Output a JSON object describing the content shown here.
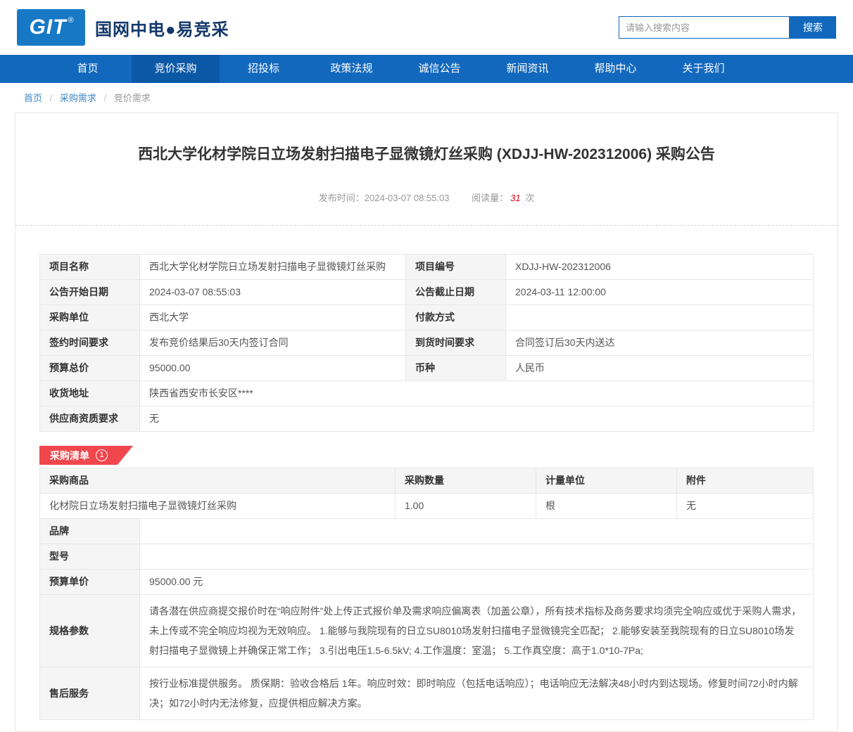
{
  "colors": {
    "brand_blue": "#1268bd",
    "active_nav_blue": "#0b58a6",
    "logo_blue": "#1779c5",
    "badge_red": "#f0474d",
    "price_red": "#e60012"
  },
  "header": {
    "logo_text": "GIT",
    "logo_reg": "®",
    "site_name": "国网中电●易竞采",
    "search": {
      "placeholder": "请输入搜索内容",
      "button_label": "搜索"
    }
  },
  "nav": {
    "items": [
      {
        "label": "首页",
        "active": false
      },
      {
        "label": "竞价采购",
        "active": true
      },
      {
        "label": "招投标",
        "active": false
      },
      {
        "label": "政策法规",
        "active": false
      },
      {
        "label": "诚信公告",
        "active": false
      },
      {
        "label": "新闻资讯",
        "active": false
      },
      {
        "label": "帮助中心",
        "active": false
      },
      {
        "label": "关于我们",
        "active": false
      }
    ]
  },
  "breadcrumb": {
    "separator": "/",
    "items": [
      {
        "label": "首页"
      },
      {
        "label": "采购需求"
      },
      {
        "label": "竞价需求"
      }
    ]
  },
  "announcement": {
    "title": "西北大学化材学院日立场发射扫描电子显微镜灯丝采购 (XDJJ-HW-202312006) 采购公告",
    "publish_label": "发布时间：",
    "publish_time": "2024-03-07 08:55:03",
    "views_label": "阅读量：",
    "views_count": "31",
    "views_unit": "次"
  },
  "info_table": {
    "rows": [
      [
        "项目名称",
        "西北大学化材学院日立场发射扫描电子显微镜灯丝采购",
        "项目编号",
        "XDJJ-HW-202312006"
      ],
      [
        "公告开始日期",
        "2024-03-07 08:55:03",
        "公告截止日期",
        "2024-03-11 12:00:00"
      ],
      [
        "采购单位",
        "西北大学",
        "付款方式",
        ""
      ],
      [
        "签约时间要求",
        "发布竞价结果后30天内签订合同",
        "到货时间要求",
        "合同签订后30天内送达"
      ],
      [
        "预算总价",
        "95000.00",
        "币种",
        "人民币"
      ]
    ],
    "full_rows": [
      {
        "label": "收货地址",
        "value": "陕西省西安市长安区****"
      },
      {
        "label": "供应商资质要求",
        "value": "无"
      }
    ]
  },
  "list_badge": {
    "label": "采购清单",
    "count": "1"
  },
  "items_table": {
    "headers": [
      "采购商品",
      "采购数量",
      "计量单位",
      "附件"
    ],
    "item_row": [
      "化材院日立场发射扫描电子显微镜灯丝采购",
      "1.00",
      "根",
      "无"
    ],
    "details": [
      {
        "label": "品牌",
        "value": ""
      },
      {
        "label": "型号",
        "value": ""
      },
      {
        "label": "预算单价",
        "value": "95000.00 元"
      },
      {
        "label": "规格参数",
        "value": "请各潜在供应商提交报价时在“响应附件”处上传正式报价单及需求响应偏离表（加盖公章），所有技术指标及商务要求均须完全响应或优于采购人需求，未上传或不完全响应均视为无效响应。 1.能够与我院现有的日立SU8010场发射扫描电子显微镜完全匹配； 2.能够安装至我院现有的日立SU8010场发射扫描电子显微镜上并确保正常工作； 3.引出电压1.5-6.5kV; 4.工作温度：室温； 5.工作真空度：高于1.0*10-7Pa;"
      },
      {
        "label": "售后服务",
        "value": "按行业标准提供服务。 质保期：验收合格后 1年。响应时效：即时响应（包括电话响应）；电话响应无法解决48小时内到达现场。修复时间72小时内解决；如72小时内无法修复，应提供相应解决方案。"
      }
    ]
  }
}
